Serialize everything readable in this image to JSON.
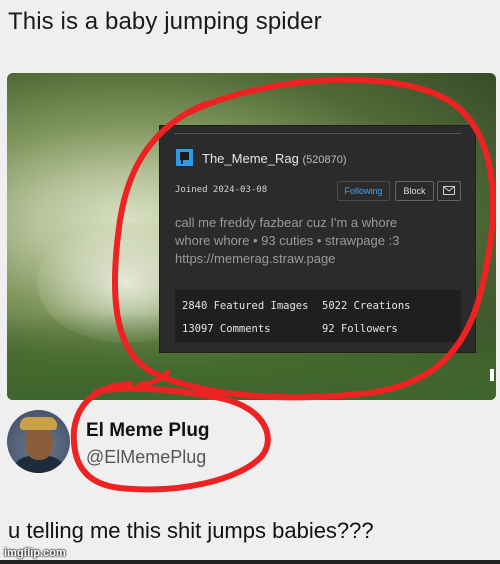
{
  "top_caption": "This is a baby jumping spider",
  "profile_card": {
    "username": "The_Meme_Rag",
    "user_id": "(520870)",
    "joined": "Joined 2024-03-08",
    "follow_label": "Following",
    "block_label": "Block",
    "bio_lines": [
      "call me freddy fazbear cuz I'm a whore",
      "whore whore • 93 cuties • strawpage :3",
      "https://memerag.straw.page"
    ],
    "stats": {
      "featured_images": "2840 Featured Images",
      "creations": "5022 Creations",
      "comments": "13097 Comments",
      "followers": "92 Followers"
    },
    "logo_icon": "imgflip-logo-icon",
    "mail_icon": "mail-icon",
    "follow_color": "#47a0e8"
  },
  "tweet": {
    "display_name": "El Meme Plug",
    "handle": "@ElMemePlug",
    "caption": "u telling me this shit jumps babies???"
  },
  "watermark": "imgflip.com",
  "annotation_color": "#ee2222"
}
